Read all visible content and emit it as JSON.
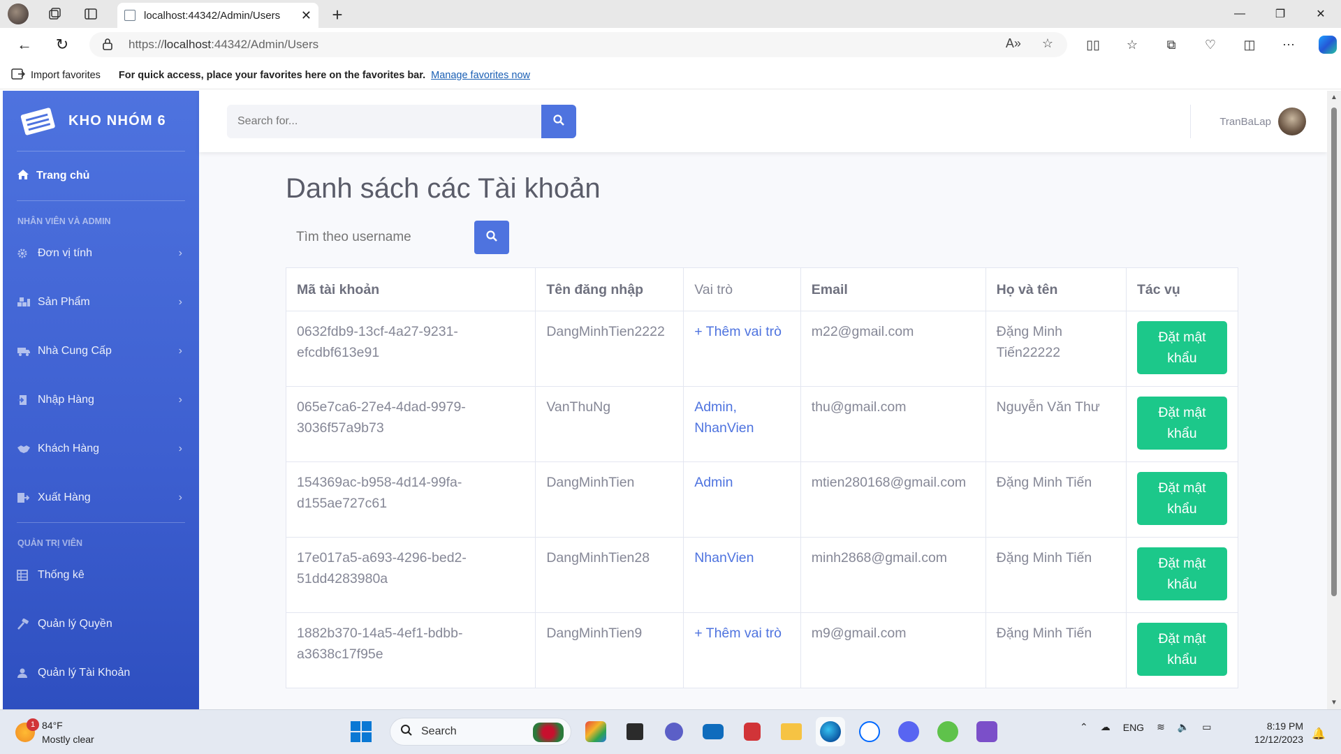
{
  "browser": {
    "tab_title": "localhost:44342/Admin/Users",
    "url_prefix": "https://",
    "url_host": "localhost",
    "url_rest": ":44342/Admin/Users",
    "favorites": {
      "import_label": "Import favorites",
      "message": "For quick access, place your favorites here on the favorites bar.",
      "manage_link": "Manage favorites now"
    }
  },
  "sidebar": {
    "brand": "KHO NHÓM 6",
    "home": "Trang chủ",
    "section1": "NHÂN VIÊN VÀ ADMIN",
    "items1": [
      {
        "label": "Đơn vị tính",
        "icon": "gear-icon"
      },
      {
        "label": "Sản Phẩm",
        "icon": "boxes-icon"
      },
      {
        "label": "Nhà Cung Cấp",
        "icon": "truck-icon"
      },
      {
        "label": "Nhập Hàng",
        "icon": "import-icon"
      },
      {
        "label": "Khách Hàng",
        "icon": "handshake-icon"
      },
      {
        "label": "Xuất Hàng",
        "icon": "export-icon"
      }
    ],
    "section2": "QUẢN TRỊ VIÊN",
    "items2": [
      {
        "label": "Thống kê",
        "icon": "table-icon"
      },
      {
        "label": "Quản lý Quyền",
        "icon": "hammer-icon"
      },
      {
        "label": "Quản lý Tài Khoản",
        "icon": "user-icon"
      }
    ]
  },
  "topbar": {
    "search_placeholder": "Search for...",
    "username": "TranBaLap"
  },
  "main": {
    "title": "Danh sách các Tài khoản",
    "search_placeholder": "Tìm theo username",
    "columns": [
      "Mã tài khoản",
      "Tên đăng nhập",
      "Vai trò",
      "Email",
      "Họ và tên",
      "Tác vụ"
    ],
    "rows": [
      {
        "id1": "0632fdb9-13cf-4a27-9231-",
        "id2": "efcdbf613e91",
        "username": "DangMinhTien2222",
        "role1": "+ Thêm vai trò",
        "role2": "",
        "email": "m22@gmail.com",
        "name1": "Đặng Minh",
        "name2": "Tiến22222",
        "action1": "Đặt mật",
        "action2": "khẩu"
      },
      {
        "id1": "065e7ca6-27e4-4dad-9979-",
        "id2": "3036f57a9b73",
        "username": "VanThuNg",
        "role1": "Admin,",
        "role2": "NhanVien",
        "email": "thu@gmail.com",
        "name1": "Nguyễn Văn Thư",
        "name2": "",
        "action1": "Đặt mật",
        "action2": "khẩu"
      },
      {
        "id1": "154369ac-b958-4d14-99fa-",
        "id2": "d155ae727c61",
        "username": "DangMinhTien",
        "role1": "Admin",
        "role2": "",
        "email": "mtien280168@gmail.com",
        "name1": "Đặng Minh Tiến",
        "name2": "",
        "action1": "Đặt mật",
        "action2": "khẩu"
      },
      {
        "id1": "17e017a5-a693-4296-bed2-",
        "id2": "51dd4283980a",
        "username": "DangMinhTien28",
        "role1": "NhanVien",
        "role2": "",
        "email": "minh2868@gmail.com",
        "name1": "Đặng Minh Tiến",
        "name2": "",
        "action1": "Đặt mật",
        "action2": "khẩu"
      },
      {
        "id1": "1882b370-14a5-4ef1-bdbb-",
        "id2": "a3638c17f95e",
        "username": "DangMinhTien9",
        "role1": "+ Thêm vai trò",
        "role2": "",
        "email": "m9@gmail.com",
        "name1": "Đặng Minh Tiến",
        "name2": "",
        "action1": "Đặt mật",
        "action2": "khẩu"
      }
    ]
  },
  "taskbar": {
    "temp": "84°F",
    "weather": "Mostly clear",
    "weather_badge": "1",
    "search": "Search",
    "lang": "ENG",
    "time": "8:19 PM",
    "date": "12/12/2023"
  },
  "colors": {
    "sidebar": "#4e73df",
    "primary": "#4e73df",
    "success": "#1cc88a"
  }
}
